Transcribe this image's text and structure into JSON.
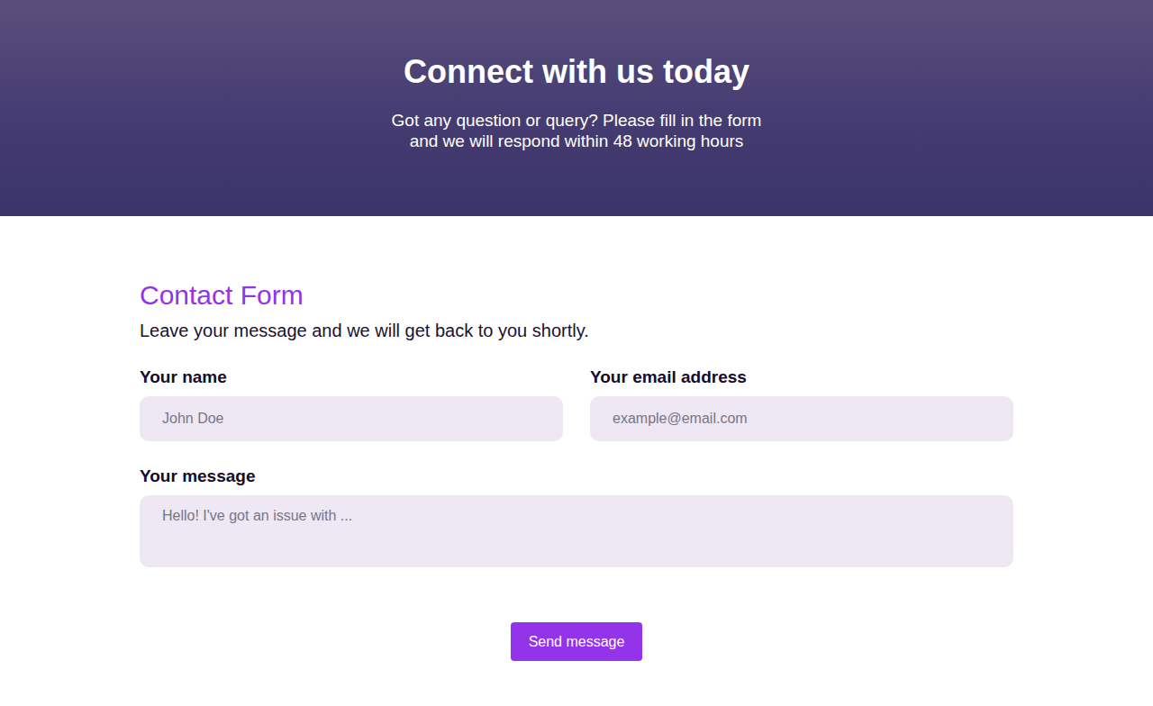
{
  "hero": {
    "title": "Connect with us today",
    "subtitle_lines": [
      "Got any question or query? Please fill in the form",
      "and we will respond within 48 working hours"
    ]
  },
  "form": {
    "title": "Contact Form",
    "intro": "Leave your message and we will get back to you shortly.",
    "fields": [
      {
        "label": "Your name",
        "placeholder": "John Doe",
        "kind": "input"
      },
      {
        "label": "Your email address",
        "placeholder": "example@email.com",
        "kind": "input"
      },
      {
        "label": "Your message",
        "placeholder": "Hello! I've got an issue with ...",
        "kind": "textarea"
      }
    ],
    "button": "Send message"
  }
}
